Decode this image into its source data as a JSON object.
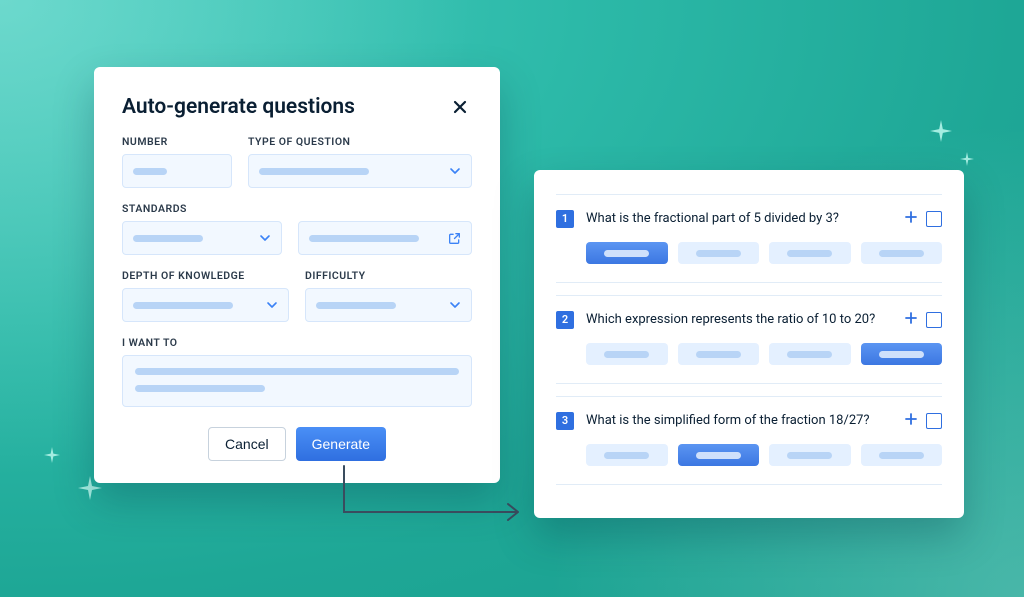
{
  "modal": {
    "title": "Auto-generate questions",
    "labels": {
      "number": "NUMBER",
      "type": "TYPE OF QUESTION",
      "standards": "STANDARDS",
      "depth": "DEPTH OF KNOWLEDGE",
      "difficulty": "DIFFICULTY",
      "want": "I WANT TO"
    },
    "buttons": {
      "cancel": "Cancel",
      "generate": "Generate"
    }
  },
  "results": {
    "questions": [
      {
        "num": "1",
        "text": "What is the fractional part of 5 divided by 3?",
        "selected_index": 0
      },
      {
        "num": "2",
        "text": "Which expression represents the ratio of 10 to 20?",
        "selected_index": 3
      },
      {
        "num": "3",
        "text": "What is the simplified form of the fraction 18/27?",
        "selected_index": 1
      }
    ]
  }
}
